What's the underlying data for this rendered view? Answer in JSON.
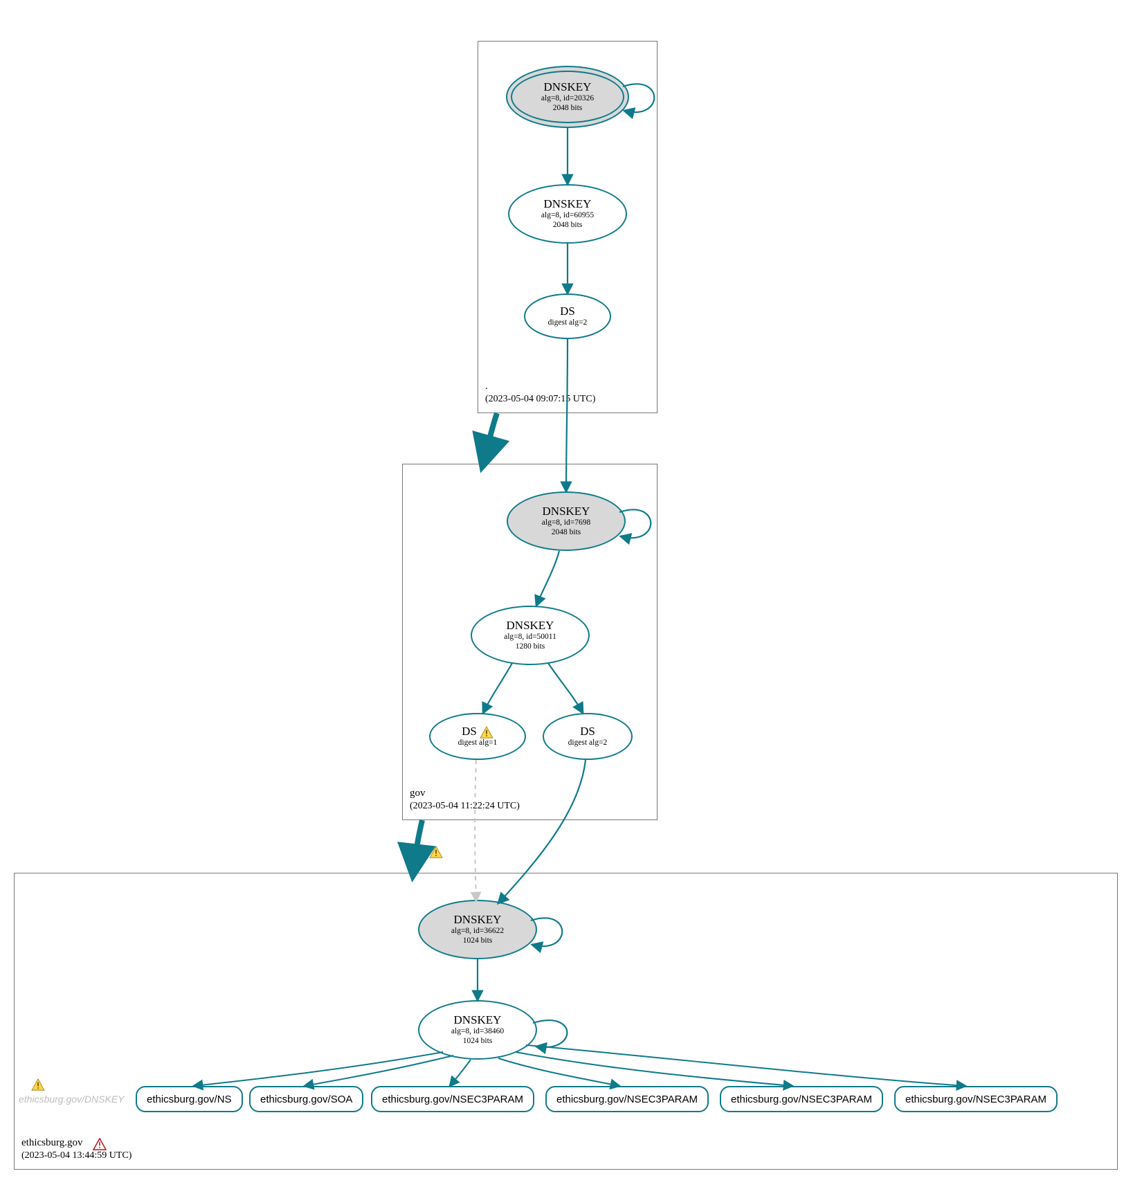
{
  "zones": {
    "root": {
      "name": ".",
      "timestamp": "(2023-05-04 09:07:15 UTC)"
    },
    "gov": {
      "name": "gov",
      "timestamp": "(2023-05-04 11:22:24 UTC)"
    },
    "domain": {
      "name": "ethicsburg.gov",
      "timestamp": "(2023-05-04 13:44:59 UTC)"
    }
  },
  "nodes": {
    "root_ksk": {
      "title": "DNSKEY",
      "sub1": "alg=8, id=20326",
      "sub2": "2048 bits"
    },
    "root_zsk": {
      "title": "DNSKEY",
      "sub1": "alg=8, id=60955",
      "sub2": "2048 bits"
    },
    "root_ds": {
      "title": "DS",
      "sub1": "digest alg=2"
    },
    "gov_ksk": {
      "title": "DNSKEY",
      "sub1": "alg=8, id=7698",
      "sub2": "2048 bits"
    },
    "gov_zsk": {
      "title": "DNSKEY",
      "sub1": "alg=8, id=50011",
      "sub2": "1280 bits"
    },
    "gov_ds1": {
      "title": "DS",
      "sub1": "digest alg=1"
    },
    "gov_ds2": {
      "title": "DS",
      "sub1": "digest alg=2"
    },
    "dom_ksk": {
      "title": "DNSKEY",
      "sub1": "alg=8, id=36622",
      "sub2": "1024 bits"
    },
    "dom_zsk": {
      "title": "DNSKEY",
      "sub1": "alg=8, id=38460",
      "sub2": "1024 bits"
    }
  },
  "records": {
    "ns": "ethicsburg.gov/NS",
    "soa": "ethicsburg.gov/SOA",
    "nsec3a": "ethicsburg.gov/NSEC3PARAM",
    "nsec3b": "ethicsburg.gov/NSEC3PARAM",
    "nsec3c": "ethicsburg.gov/NSEC3PARAM",
    "nsec3d": "ethicsburg.gov/NSEC3PARAM"
  },
  "missing": {
    "dnskey": "ethicsburg.gov/DNSKEY"
  }
}
